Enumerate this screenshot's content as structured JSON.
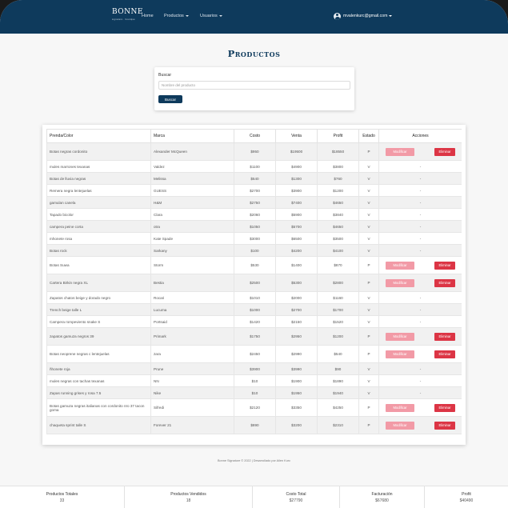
{
  "navbar": {
    "brand": "BONNE",
    "brand_sub": "signature · boutique",
    "links": [
      "Home",
      "Productos",
      "Usuarios"
    ],
    "user_email": "mvalenkurc@gmail.com"
  },
  "page": {
    "title": "Productos"
  },
  "search": {
    "label": "Buscar",
    "placeholder": "Nombre del producto",
    "button": "Buscar"
  },
  "table": {
    "headers": [
      "Prenda/Color",
      "Marca",
      "Costo",
      "Venta",
      "Profit",
      "Estado",
      "Acciones"
    ],
    "modify_label": "Modificar",
    "delete_label": "Eliminar",
    "no_action": "-",
    "rows": [
      {
        "prenda": "Botas negras cordonito",
        "marca": "Alexander McQueen",
        "costo": "$950",
        "venta": "$19500",
        "profit": "$18550",
        "estado": "P",
        "actions": true,
        "tall": true
      },
      {
        "prenda": "mules marrones texanas",
        "marca": "Valdez",
        "costo": "$1100",
        "venta": "$4900",
        "profit": "$3800",
        "estado": "V",
        "actions": false
      },
      {
        "prenda": "Botas de lluvia negras",
        "marca": "Melissa",
        "costo": "$540",
        "venta": "$1300",
        "profit": "$760",
        "estado": "V",
        "actions": false
      },
      {
        "prenda": "Remera negra lentejuelas",
        "marca": "GUESS",
        "costo": "$2700",
        "venta": "$3900",
        "profit": "$1200",
        "estado": "V",
        "actions": false
      },
      {
        "prenda": "gamulan canela",
        "marca": "H&M",
        "costo": "$2750",
        "venta": "$7400",
        "profit": "$4650",
        "estado": "V",
        "actions": false
      },
      {
        "prenda": "Tapado bicolor",
        "marca": "Clara",
        "costo": "$2060",
        "venta": "$5900",
        "profit": "$3840",
        "estado": "V",
        "actions": false
      },
      {
        "prenda": "campera peine corta",
        "marca": "otra",
        "costo": "$1050",
        "venta": "$5700",
        "profit": "$4650",
        "estado": "V",
        "actions": false
      },
      {
        "prenda": "mhonete rosa",
        "marca": "Kate Spade",
        "costo": "$3000",
        "venta": "$6500",
        "profit": "$3500",
        "estado": "V",
        "actions": false
      },
      {
        "prenda": "Botas rock",
        "marca": "Sarkany",
        "costo": "$100",
        "venta": "$4200",
        "profit": "$4100",
        "estado": "V",
        "actions": false
      },
      {
        "prenda": "Botas Suwa",
        "marca": "Storm",
        "costo": "$530",
        "venta": "$1400",
        "profit": "$870",
        "estado": "P",
        "actions": true,
        "tall": true
      },
      {
        "prenda": "Cartera Birkin negra XL",
        "marca": "Bestia",
        "costo": "$2500",
        "venta": "$5300",
        "profit": "$2800",
        "estado": "P",
        "actions": true,
        "tall": true
      },
      {
        "prenda": "Zapatos chatos beige y dorado negro",
        "marca": "Rocari",
        "costo": "$1010",
        "venta": "$2000",
        "profit": "$1160",
        "estado": "V",
        "actions": false
      },
      {
        "prenda": "Trench beige talle L",
        "marca": "Lucuma",
        "costo": "$1000",
        "venta": "$2700",
        "profit": "$1700",
        "estado": "V",
        "actions": false
      },
      {
        "prenda": "Campera rompeviento snake S",
        "marca": "Portsaid",
        "costo": "$1420",
        "venta": "$2150",
        "profit": "$1520",
        "estado": "V",
        "actions": false
      },
      {
        "prenda": "zapatos gamuza negros 39",
        "marca": "Primark",
        "costo": "$1750",
        "venta": "$2950",
        "profit": "$1200",
        "estado": "P",
        "actions": true,
        "tall": true
      },
      {
        "prenda": "Botas neoprene negras c lentejuelas",
        "marca": "zara",
        "costo": "$2450",
        "venta": "$2990",
        "profit": "$540",
        "estado": "P",
        "actions": true,
        "tall": true
      },
      {
        "prenda": "ñhonete roja",
        "marca": "Prune",
        "costo": "$3900",
        "venta": "$3990",
        "profit": "$90",
        "estado": "V",
        "actions": false
      },
      {
        "prenda": "mules negras con tachas texanas",
        "marca": "NN",
        "costo": "$10",
        "venta": "$1900",
        "profit": "$1890",
        "estado": "V",
        "actions": false
      },
      {
        "prenda": "Zapas running grises y rosa 7.5",
        "marca": "Nike",
        "costo": "$10",
        "venta": "$1950",
        "profit": "$1940",
        "estado": "V",
        "actions": false
      },
      {
        "prenda": "Botas gamuza negras italianas con cordonito nro 37 tacon goma",
        "marca": "Sifredi",
        "costo": "$2120",
        "venta": "$3350",
        "profit": "$4250",
        "estado": "P",
        "actions": true,
        "tall": true
      },
      {
        "prenda": "chaqueta sprint talle S",
        "marca": "Forever 21",
        "costo": "$890",
        "venta": "$3200",
        "profit": "$2310",
        "estado": "P",
        "actions": true,
        "tall": true
      }
    ]
  },
  "footer": {
    "text": "Bonne Signature © 2022 | Desarrollado por Ailen Kurc"
  },
  "stats": [
    {
      "label": "Productos Totales",
      "value": "33"
    },
    {
      "label": "Productos Vendidos",
      "value": "18"
    },
    {
      "label": "Costo Total",
      "value": "$27790"
    },
    {
      "label": "Facturación",
      "value": "$67680"
    },
    {
      "label": "Profit",
      "value": "$40490"
    }
  ],
  "colors": {
    "navbar": "#0e3a5c",
    "modify": "#f29aa6",
    "delete": "#dc3545"
  }
}
